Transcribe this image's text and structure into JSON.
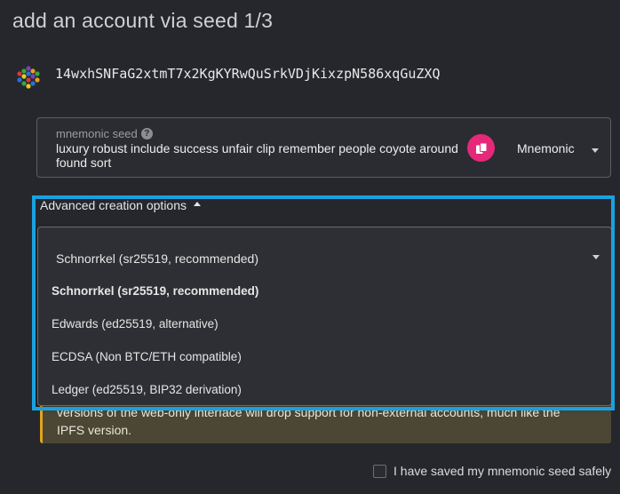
{
  "modal": {
    "title": "add an account via seed 1/3"
  },
  "account": {
    "address": "14wxhSNFaG2xtmT7x2KgKYRwQuSrkVDjKixzpN586xqGuZXQ"
  },
  "mnemonic": {
    "label": "mnemonic seed",
    "help_icon": "question-circle-icon",
    "value": "luxury robust include success unfair clip remember people coyote around found sort",
    "type_selected": "Mnemonic",
    "copy_icon": "copy-icon"
  },
  "advanced": {
    "toggle_label": "Advanced creation options",
    "crypto_selected": "Schnorrkel (sr25519, recommended)",
    "options": [
      "Schnorrkel (sr25519, recommended)",
      "Edwards (ed25519, alternative)",
      "ECDSA (Non BTC/ETH compatible)",
      "Ledger (ed25519, BIP32 derivation)"
    ]
  },
  "warning": {
    "text": "versions of the web-only interface will drop support for non-external accounts, much like the IPFS version."
  },
  "confirm": {
    "saved_label": "I have saved my mnemonic seed safely"
  },
  "colors": {
    "accent": "#e6287a",
    "highlight_frame": "#1aa1e0",
    "warning_border": "#e1a420"
  }
}
